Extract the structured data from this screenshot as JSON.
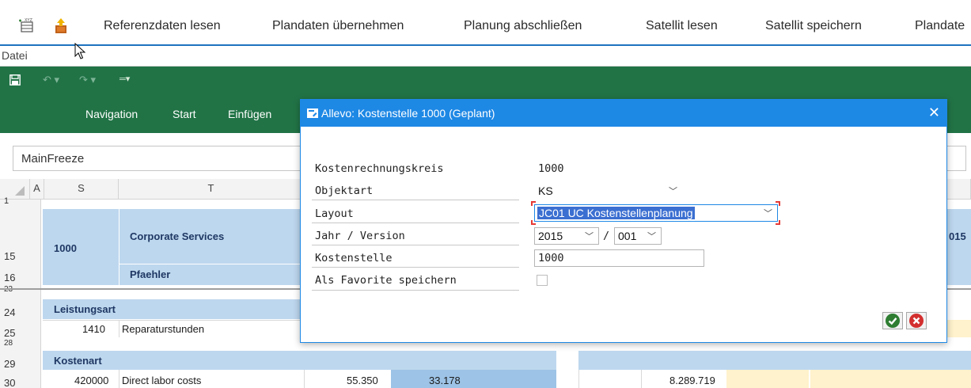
{
  "sap_toolbar": {
    "icons": [
      "new-entry-icon",
      "upload-icon"
    ],
    "buttons": [
      "Referenzdaten lesen",
      "Plandaten übernehmen",
      "Planung abschließen",
      "Satellit lesen",
      "Satellit speichern",
      "Plandate"
    ]
  },
  "menu": {
    "datei": "Datei"
  },
  "excel": {
    "qat": {
      "save_icon": "save-icon",
      "undo_icon": "undo-icon",
      "redo_icon": "redo-icon",
      "customize_icon": "customize-qat-icon"
    },
    "ribbon_tabs": [
      "Navigation",
      "Start",
      "Einfügen"
    ],
    "name_box": "MainFreeze",
    "column_headers": [
      "A",
      "S",
      "T"
    ],
    "rows": {
      "r1": "1",
      "r15": "15",
      "r16": "16",
      "r23": "23",
      "r24": "24",
      "r25": "25",
      "r28": "28",
      "r29": "29",
      "r30": "30"
    },
    "header": {
      "code": "1000",
      "name": "Corporate Services",
      "person": "Pfaehler",
      "right_fragment": "015"
    },
    "sections": {
      "leistungsart": "Leistungsart",
      "kostenart": "Kostenart"
    },
    "activity_row": {
      "code": "1410",
      "name": "Reparaturstunden"
    },
    "cost_row": {
      "code": "420000",
      "name": "Direct labor costs",
      "v1": "55.350",
      "v2": "33.178",
      "v3": "8.289.719"
    },
    "colors": {
      "header_blue": "#bdd7ee",
      "highlight_blue": "#9dc3e6",
      "peach": "#fff2cc",
      "excel_green": "#217346"
    }
  },
  "dialog": {
    "title": "Allevo: Kostenstelle 1000 (Geplant)",
    "close": "✕",
    "fields": {
      "kostenrechnungskreis": {
        "label": "Kostenrechnungskreis",
        "value": "1000"
      },
      "objektart": {
        "label": "Objektart",
        "value": "KS"
      },
      "layout": {
        "label": "Layout",
        "value": "JC01 UC Kostenstellenplanung"
      },
      "jahr_version": {
        "label": "Jahr / Version",
        "year": "2015",
        "separator": "/",
        "version": "001"
      },
      "kostenstelle": {
        "label": "Kostenstelle",
        "value": "1000"
      },
      "favorite": {
        "label": "Als Favorite speichern",
        "checked": false
      }
    },
    "buttons": {
      "ok_icon": "ok-check-icon",
      "cancel_icon": "cancel-icon"
    },
    "colors": {
      "titlebar": "#1e88e5",
      "ok": "#2e7d32",
      "cancel": "#d32f2f"
    }
  }
}
